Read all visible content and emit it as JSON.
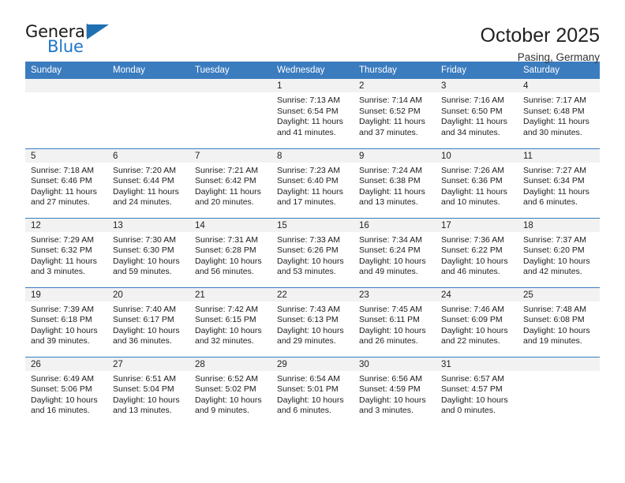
{
  "brand": {
    "name_part1": "General",
    "name_part2": "Blue",
    "accent_color": "#2277c8",
    "triangle_color": "#1f6fb2"
  },
  "header": {
    "title": "October 2025",
    "subtitle": "Pasing, Germany"
  },
  "calendar": {
    "header_bg": "#3b7cbf",
    "daynum_bg": "#f2f2f2",
    "weekdays": [
      "Sunday",
      "Monday",
      "Tuesday",
      "Wednesday",
      "Thursday",
      "Friday",
      "Saturday"
    ],
    "weeks": [
      [
        {
          "day": "",
          "empty": true
        },
        {
          "day": "",
          "empty": true
        },
        {
          "day": "",
          "empty": true
        },
        {
          "day": "1",
          "sunrise": "Sunrise: 7:13 AM",
          "sunset": "Sunset: 6:54 PM",
          "daylight1": "Daylight: 11 hours",
          "daylight2": "and 41 minutes."
        },
        {
          "day": "2",
          "sunrise": "Sunrise: 7:14 AM",
          "sunset": "Sunset: 6:52 PM",
          "daylight1": "Daylight: 11 hours",
          "daylight2": "and 37 minutes."
        },
        {
          "day": "3",
          "sunrise": "Sunrise: 7:16 AM",
          "sunset": "Sunset: 6:50 PM",
          "daylight1": "Daylight: 11 hours",
          "daylight2": "and 34 minutes."
        },
        {
          "day": "4",
          "sunrise": "Sunrise: 7:17 AM",
          "sunset": "Sunset: 6:48 PM",
          "daylight1": "Daylight: 11 hours",
          "daylight2": "and 30 minutes."
        }
      ],
      [
        {
          "day": "5",
          "sunrise": "Sunrise: 7:18 AM",
          "sunset": "Sunset: 6:46 PM",
          "daylight1": "Daylight: 11 hours",
          "daylight2": "and 27 minutes."
        },
        {
          "day": "6",
          "sunrise": "Sunrise: 7:20 AM",
          "sunset": "Sunset: 6:44 PM",
          "daylight1": "Daylight: 11 hours",
          "daylight2": "and 24 minutes."
        },
        {
          "day": "7",
          "sunrise": "Sunrise: 7:21 AM",
          "sunset": "Sunset: 6:42 PM",
          "daylight1": "Daylight: 11 hours",
          "daylight2": "and 20 minutes."
        },
        {
          "day": "8",
          "sunrise": "Sunrise: 7:23 AM",
          "sunset": "Sunset: 6:40 PM",
          "daylight1": "Daylight: 11 hours",
          "daylight2": "and 17 minutes."
        },
        {
          "day": "9",
          "sunrise": "Sunrise: 7:24 AM",
          "sunset": "Sunset: 6:38 PM",
          "daylight1": "Daylight: 11 hours",
          "daylight2": "and 13 minutes."
        },
        {
          "day": "10",
          "sunrise": "Sunrise: 7:26 AM",
          "sunset": "Sunset: 6:36 PM",
          "daylight1": "Daylight: 11 hours",
          "daylight2": "and 10 minutes."
        },
        {
          "day": "11",
          "sunrise": "Sunrise: 7:27 AM",
          "sunset": "Sunset: 6:34 PM",
          "daylight1": "Daylight: 11 hours",
          "daylight2": "and 6 minutes."
        }
      ],
      [
        {
          "day": "12",
          "sunrise": "Sunrise: 7:29 AM",
          "sunset": "Sunset: 6:32 PM",
          "daylight1": "Daylight: 11 hours",
          "daylight2": "and 3 minutes."
        },
        {
          "day": "13",
          "sunrise": "Sunrise: 7:30 AM",
          "sunset": "Sunset: 6:30 PM",
          "daylight1": "Daylight: 10 hours",
          "daylight2": "and 59 minutes."
        },
        {
          "day": "14",
          "sunrise": "Sunrise: 7:31 AM",
          "sunset": "Sunset: 6:28 PM",
          "daylight1": "Daylight: 10 hours",
          "daylight2": "and 56 minutes."
        },
        {
          "day": "15",
          "sunrise": "Sunrise: 7:33 AM",
          "sunset": "Sunset: 6:26 PM",
          "daylight1": "Daylight: 10 hours",
          "daylight2": "and 53 minutes."
        },
        {
          "day": "16",
          "sunrise": "Sunrise: 7:34 AM",
          "sunset": "Sunset: 6:24 PM",
          "daylight1": "Daylight: 10 hours",
          "daylight2": "and 49 minutes."
        },
        {
          "day": "17",
          "sunrise": "Sunrise: 7:36 AM",
          "sunset": "Sunset: 6:22 PM",
          "daylight1": "Daylight: 10 hours",
          "daylight2": "and 46 minutes."
        },
        {
          "day": "18",
          "sunrise": "Sunrise: 7:37 AM",
          "sunset": "Sunset: 6:20 PM",
          "daylight1": "Daylight: 10 hours",
          "daylight2": "and 42 minutes."
        }
      ],
      [
        {
          "day": "19",
          "sunrise": "Sunrise: 7:39 AM",
          "sunset": "Sunset: 6:18 PM",
          "daylight1": "Daylight: 10 hours",
          "daylight2": "and 39 minutes."
        },
        {
          "day": "20",
          "sunrise": "Sunrise: 7:40 AM",
          "sunset": "Sunset: 6:17 PM",
          "daylight1": "Daylight: 10 hours",
          "daylight2": "and 36 minutes."
        },
        {
          "day": "21",
          "sunrise": "Sunrise: 7:42 AM",
          "sunset": "Sunset: 6:15 PM",
          "daylight1": "Daylight: 10 hours",
          "daylight2": "and 32 minutes."
        },
        {
          "day": "22",
          "sunrise": "Sunrise: 7:43 AM",
          "sunset": "Sunset: 6:13 PM",
          "daylight1": "Daylight: 10 hours",
          "daylight2": "and 29 minutes."
        },
        {
          "day": "23",
          "sunrise": "Sunrise: 7:45 AM",
          "sunset": "Sunset: 6:11 PM",
          "daylight1": "Daylight: 10 hours",
          "daylight2": "and 26 minutes."
        },
        {
          "day": "24",
          "sunrise": "Sunrise: 7:46 AM",
          "sunset": "Sunset: 6:09 PM",
          "daylight1": "Daylight: 10 hours",
          "daylight2": "and 22 minutes."
        },
        {
          "day": "25",
          "sunrise": "Sunrise: 7:48 AM",
          "sunset": "Sunset: 6:08 PM",
          "daylight1": "Daylight: 10 hours",
          "daylight2": "and 19 minutes."
        }
      ],
      [
        {
          "day": "26",
          "sunrise": "Sunrise: 6:49 AM",
          "sunset": "Sunset: 5:06 PM",
          "daylight1": "Daylight: 10 hours",
          "daylight2": "and 16 minutes."
        },
        {
          "day": "27",
          "sunrise": "Sunrise: 6:51 AM",
          "sunset": "Sunset: 5:04 PM",
          "daylight1": "Daylight: 10 hours",
          "daylight2": "and 13 minutes."
        },
        {
          "day": "28",
          "sunrise": "Sunrise: 6:52 AM",
          "sunset": "Sunset: 5:02 PM",
          "daylight1": "Daylight: 10 hours",
          "daylight2": "and 9 minutes."
        },
        {
          "day": "29",
          "sunrise": "Sunrise: 6:54 AM",
          "sunset": "Sunset: 5:01 PM",
          "daylight1": "Daylight: 10 hours",
          "daylight2": "and 6 minutes."
        },
        {
          "day": "30",
          "sunrise": "Sunrise: 6:56 AM",
          "sunset": "Sunset: 4:59 PM",
          "daylight1": "Daylight: 10 hours",
          "daylight2": "and 3 minutes."
        },
        {
          "day": "31",
          "sunrise": "Sunrise: 6:57 AM",
          "sunset": "Sunset: 4:57 PM",
          "daylight1": "Daylight: 10 hours",
          "daylight2": "and 0 minutes."
        },
        {
          "day": "",
          "empty": true
        }
      ]
    ]
  }
}
